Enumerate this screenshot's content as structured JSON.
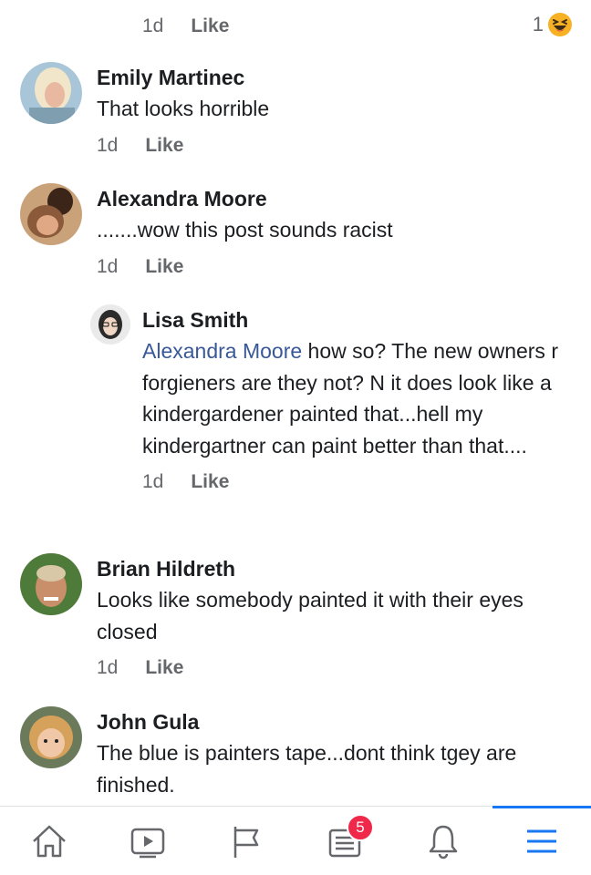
{
  "top_meta": {
    "time": "1d",
    "like": "Like",
    "reaction_count": "1"
  },
  "comments": [
    {
      "author": "Emily Martinec",
      "text": "That looks horrible",
      "time": "1d",
      "like": "Like"
    },
    {
      "author": "Alexandra Moore",
      "text": ".......wow this post sounds racist",
      "time": "1d",
      "like": "Like"
    },
    {
      "author": "Lisa Smith",
      "mention": "Alexandra Moore",
      "text": " how so? The new owners r forgieners are they not? N it does look like a kindergardener painted that...hell my kindergartner can paint better than that....",
      "time": "1d",
      "like": "Like"
    },
    {
      "author": "Brian Hildreth",
      "text": "Looks like somebody painted it with their eyes closed",
      "time": "1d",
      "like": "Like"
    },
    {
      "author": "John Gula",
      "text": "The blue is painters tape...dont think tgey are finished."
    }
  ],
  "nav": {
    "items": [
      "home-icon",
      "video-icon",
      "flag-icon",
      "news-icon",
      "bell-icon",
      "menu-icon"
    ],
    "news_badge": "5",
    "active": "menu-icon"
  },
  "colors": {
    "accent": "#1877f2",
    "mention": "#385898",
    "badge": "#f02849"
  }
}
